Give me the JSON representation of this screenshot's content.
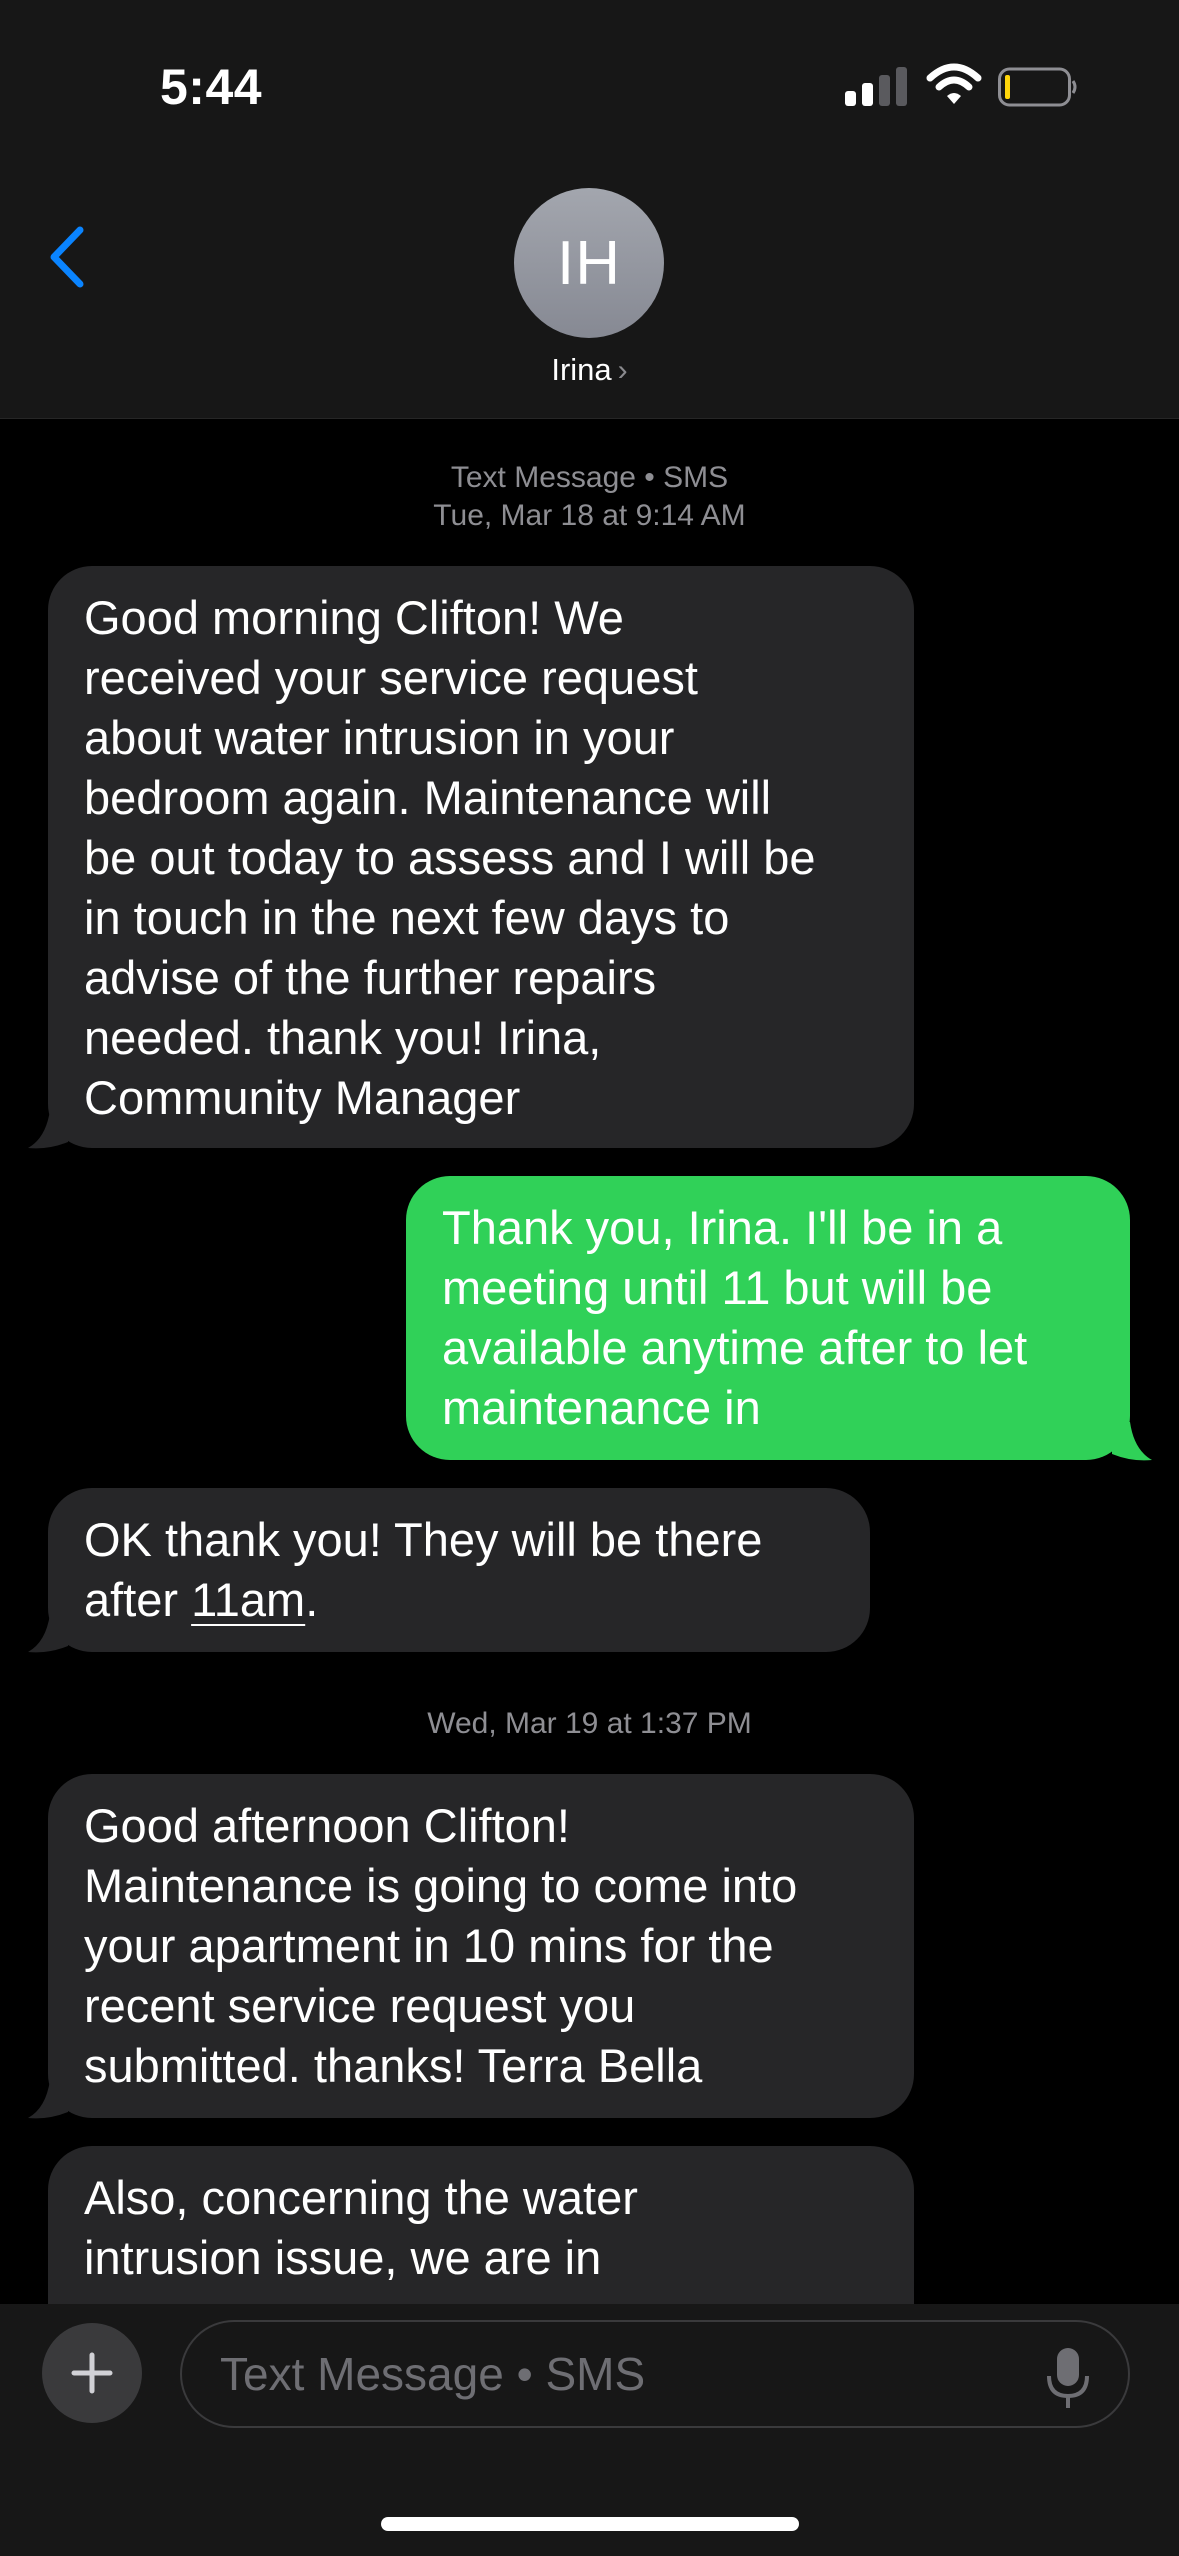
{
  "status_bar": {
    "time": "5:44",
    "icons": [
      "cellular-signal-icon",
      "wifi-icon",
      "battery-low-icon"
    ]
  },
  "header": {
    "back_icon": "chevron-left-icon",
    "avatar_initials": "IH",
    "contact_name": "Irina",
    "contact_chevron": "›"
  },
  "conversation": {
    "service_label": "Text Message • SMS",
    "date1": "Tue, Mar 18 at 9:14 AM",
    "date2": "Wed, Mar 19 at 1:37 PM",
    "messages": [
      {
        "direction": "incoming",
        "lines": [
          "Good morning Clifton! We",
          "received your service request",
          "about water intrusion in your",
          "bedroom again. Maintenance will",
          "be out today to assess and I will be",
          "in touch in the next few days to",
          "advise of the further repairs",
          "needed. thank you! Irina,",
          "Community Manager"
        ]
      },
      {
        "direction": "outgoing",
        "lines": [
          "Thank you, Irina. I'll be in a",
          "meeting until 11 but will be",
          "available anytime after to let",
          "maintenance in"
        ]
      },
      {
        "direction": "incoming",
        "line1": "OK thank you! They will be there",
        "line2_prefix": "after ",
        "line2_link": "11am",
        "line2_suffix": "."
      },
      {
        "direction": "incoming",
        "lines": [
          "Good afternoon Clifton!",
          "Maintenance is going to come into",
          "your apartment in 10 mins for the",
          "recent service request you",
          "submitted. thanks! Terra Bella"
        ]
      },
      {
        "direction": "incoming",
        "lines": [
          "Also, concerning the water",
          "intrusion issue, we are in"
        ]
      }
    ]
  },
  "input_bar": {
    "placeholder": "Text Message • SMS",
    "plus_icon": "plus-icon",
    "mic_icon": "microphone-icon"
  },
  "colors": {
    "incoming_bubble": "#262628",
    "outgoing_bubble": "#30d158",
    "accent_blue": "#0a84ff",
    "meta_gray": "#8e8e93"
  }
}
